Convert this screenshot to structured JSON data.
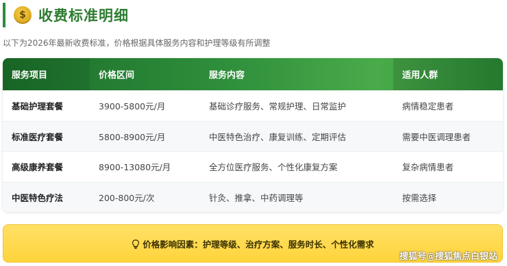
{
  "header": {
    "icon_glyph": "$",
    "icon_name": "money-bag-icon",
    "title": "收费标准明细",
    "subtitle": "以下为2026年最新收费标准，价格根据具体服务内容和护理等级有所调整"
  },
  "table": {
    "columns": [
      "服务项目",
      "价格区间",
      "服务内容",
      "适用人群"
    ],
    "rows": [
      [
        "基础护理套餐",
        "3900-5800元/月",
        "基础诊疗服务、常规护理、日常监护",
        "病情稳定患者"
      ],
      [
        "标准医疗套餐",
        "5800-8900元/月",
        "中医特色治疗、康复训练、定期评估",
        "需要中医调理患者"
      ],
      [
        "高级康养套餐",
        "8900-13080元/月",
        "全方位医疗服务、个性化康复方案",
        "复杂病情患者"
      ],
      [
        "中医特色疗法",
        "200-800元/次",
        "针灸、推拿、中药调理等",
        "按需选择"
      ]
    ]
  },
  "factors": {
    "label": "价格影响因素：",
    "text": "护理等级、治疗方案、服务时长、个性化需求",
    "icon_name": "lightbulb-icon"
  },
  "watermark": "搜狐号@搜狐焦点白银站",
  "colors": {
    "brand_green": "#2e7d32",
    "header_gradient_start": "#1b6e2a",
    "header_gradient_end": "#4aab4a",
    "factor_yellow": "#ffd43b"
  }
}
